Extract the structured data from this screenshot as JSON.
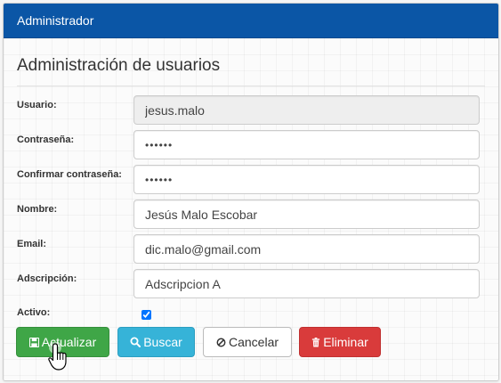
{
  "header": {
    "title": "Administrador"
  },
  "form": {
    "title": "Administración de usuarios",
    "fields": {
      "usuario": {
        "label": "Usuario:",
        "value": "jesus.malo"
      },
      "contrasena": {
        "label": "Contraseña:",
        "value": "••••••"
      },
      "confirmar": {
        "label": "Confirmar contraseña:",
        "value": "••••••"
      },
      "nombre": {
        "label": "Nombre:",
        "value": "Jesús Malo Escobar"
      },
      "email": {
        "label": "Email:",
        "value": "dic.malo@gmail.com"
      },
      "adscripcion": {
        "label": "Adscripción:",
        "value": "Adscripcion A"
      },
      "activo": {
        "label": "Activo:",
        "checked": true
      }
    }
  },
  "buttons": {
    "actualizar": {
      "label": "Actualizar",
      "icon": "floppy-disk-icon",
      "color": "#3fa647"
    },
    "buscar": {
      "label": "Buscar",
      "icon": "search-icon",
      "color": "#36b3d8"
    },
    "cancelar": {
      "label": "Cancelar",
      "icon": "ban-icon",
      "color": "#ffffff"
    },
    "eliminar": {
      "label": "Eliminar",
      "icon": "trash-icon",
      "color": "#d93b3b"
    }
  },
  "colors": {
    "header": "#0b56a6"
  }
}
